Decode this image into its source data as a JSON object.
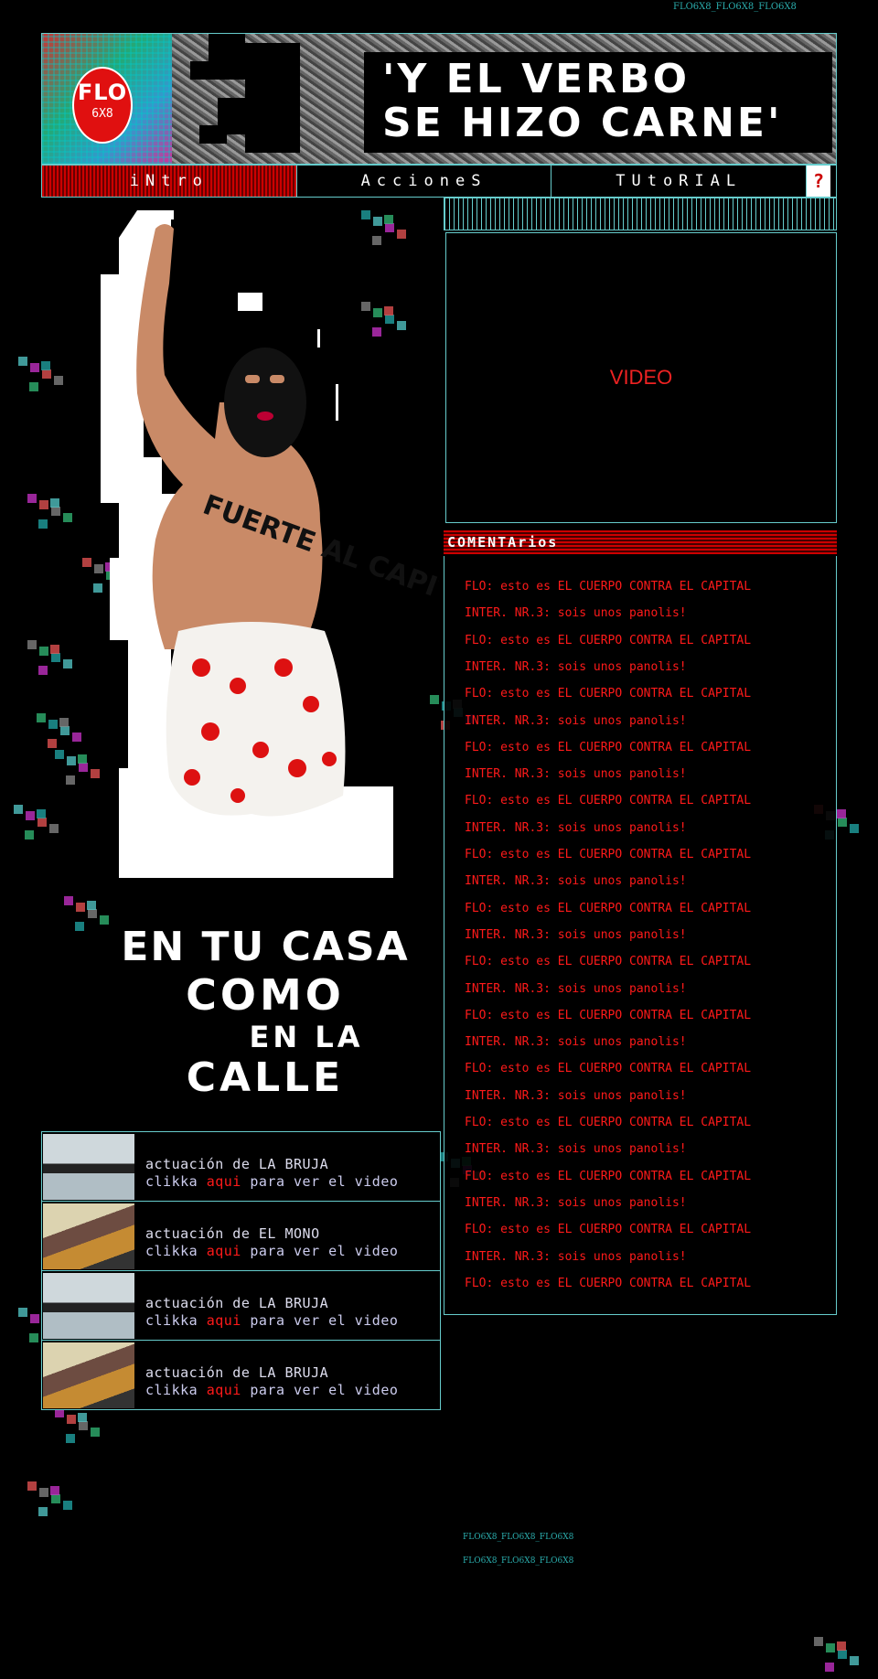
{
  "colors": {
    "accent": "#ff1a1a",
    "cyan": "#66cccc",
    "nav_active": "#cc0000"
  },
  "logo": {
    "flo": "FLO",
    "num": "6X8"
  },
  "header": {
    "title_line1": "'Y EL VERBO",
    "title_line2": "SE HIZO CARNE'"
  },
  "nav": {
    "items": [
      {
        "label": "iNtro",
        "active": true
      },
      {
        "label": "AccioneS",
        "active": false
      },
      {
        "label": "TUtoRIAL",
        "active": false
      }
    ],
    "help": "?"
  },
  "hero": {
    "body_text": "FUERTE AL CAPITAL",
    "slogan": {
      "l1": "EN TU CASA",
      "l2": "COMO",
      "l3": "EN LA",
      "l4": "CALLE"
    }
  },
  "video": {
    "label": "VIDEO"
  },
  "comments": {
    "title": "COMENTArios",
    "items": [
      "FLO: esto es EL CUERPO CONTRA EL CAPITAL",
      "INTER. NR.3: sois unos panolis!",
      "FLO: esto es EL CUERPO CONTRA EL CAPITAL",
      "INTER. NR.3: sois unos panolis!",
      "FLO: esto es EL CUERPO CONTRA EL CAPITAL",
      "INTER. NR.3: sois unos panolis!",
      "FLO: esto es EL CUERPO CONTRA EL CAPITAL",
      "INTER. NR.3: sois unos panolis!",
      "FLO: esto es EL CUERPO CONTRA EL CAPITAL",
      "INTER. NR.3: sois unos panolis!",
      "FLO: esto es EL CUERPO CONTRA EL CAPITAL",
      "INTER. NR.3: sois unos panolis!",
      "FLO: esto es EL CUERPO CONTRA EL CAPITAL",
      "INTER. NR.3: sois unos panolis!",
      "FLO: esto es EL CUERPO CONTRA EL CAPITAL",
      "INTER. NR.3: sois unos panolis!",
      "FLO: esto es EL CUERPO CONTRA EL CAPITAL",
      "INTER. NR.3: sois unos panolis!",
      "FLO: esto es EL CUERPO CONTRA EL CAPITAL",
      "INTER. NR.3: sois unos panolis!",
      "FLO: esto es EL CUERPO CONTRA EL CAPITAL",
      "INTER. NR.3: sois unos panolis!",
      "FLO: esto es EL CUERPO CONTRA EL CAPITAL",
      "INTER. NR.3: sois unos panolis!",
      "FLO: esto es EL CUERPO CONTRA EL CAPITAL",
      "INTER. NR.3: sois unos panolis!",
      "FLO: esto es EL CUERPO CONTRA EL CAPITAL"
    ]
  },
  "performances": [
    {
      "title": "actuación de LA BRUJA",
      "pre": "clikka ",
      "link": "aqui",
      "post": " para ver el video",
      "thumb": "bruja"
    },
    {
      "title": "actuación de EL MONO",
      "pre": "clikka ",
      "link": "aqui",
      "post": " para ver el video",
      "thumb": "mono"
    },
    {
      "title": "actuación de LA BRUJA",
      "pre": "clikka ",
      "link": "aqui",
      "post": " para ver el video",
      "thumb": "bruja"
    },
    {
      "title": "actuación de LA BRUJA",
      "pre": "clikka ",
      "link": "aqui",
      "post": " para ver el video",
      "thumb": "mono"
    }
  ],
  "watermark": {
    "top": "FLO6X8_FLO6X8_FLO6X8",
    "bottom1": "FLO6X8_FLO6X8_FLO6X8",
    "bottom2": "FLO6X8_FLO6X8_FLO6X8"
  }
}
